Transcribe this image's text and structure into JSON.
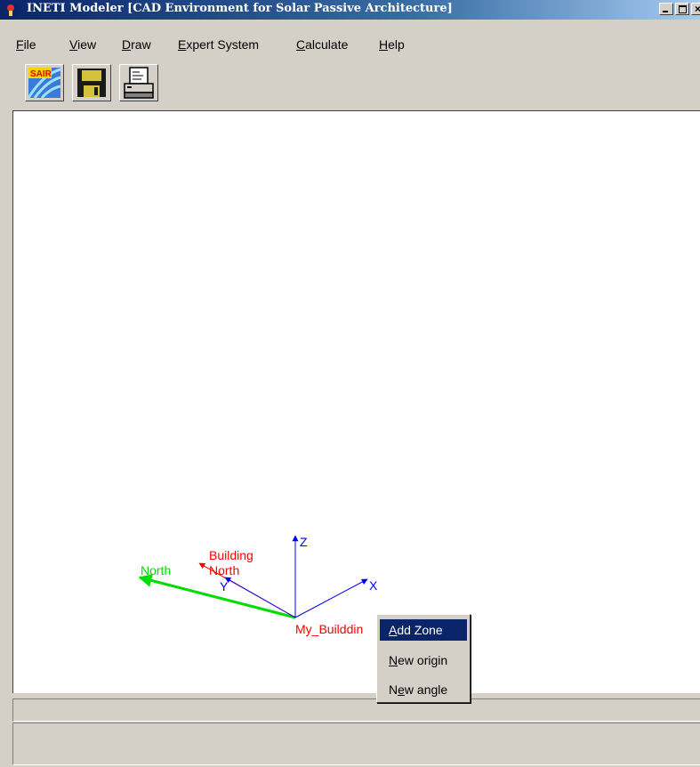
{
  "window": {
    "title": "INETI Modeler [CAD Environment for Solar Passive Architecture]",
    "controls": [
      "_",
      "□",
      "×"
    ]
  },
  "menubar": {
    "items": [
      {
        "label": "File",
        "underline": "F",
        "rest": "ile"
      },
      {
        "label": "View",
        "underline": "V",
        "rest": "iew"
      },
      {
        "label": "Draw",
        "underline": "D",
        "rest": "raw"
      },
      {
        "label": "Expert System",
        "underline": "E",
        "rest": "xpert System"
      },
      {
        "label": "Calculate",
        "underline": "C",
        "rest": "alculate"
      },
      {
        "label": "Help",
        "underline": "H",
        "rest": "elp"
      }
    ]
  },
  "toolbar": {
    "buttons": [
      {
        "name": "sair-button",
        "icon": "sair-exit-icon",
        "label": "SAIR"
      },
      {
        "name": "save-button",
        "icon": "floppy-disk-icon"
      },
      {
        "name": "print-button",
        "icon": "printer-icon"
      }
    ]
  },
  "canvas": {
    "labels": {
      "north": "North",
      "building_north_1": "Building",
      "building_north_2": "North",
      "axis_x": "X",
      "axis_y": "Y",
      "axis_z": "Z",
      "building_name": "My_Builddin"
    },
    "colors": {
      "north": "#00dd00",
      "building": "#ff0000",
      "axes": "#0000ff"
    }
  },
  "context_menu": {
    "items": [
      {
        "label": "Add Zone",
        "underline": "A",
        "rest": "dd Zone",
        "prefix": "",
        "selected": true
      },
      {
        "label": "New origin",
        "underline": "N",
        "rest": "ew origin",
        "prefix": "",
        "selected": false
      },
      {
        "label": "New angle",
        "underline": "e",
        "rest": "w angle",
        "prefix": "N",
        "selected": false
      }
    ]
  },
  "colors": {
    "titlebar_start": "#0a246a",
    "titlebar_end": "#a6caf0",
    "face": "#d4d0c8",
    "highlight": "#0a246a"
  }
}
